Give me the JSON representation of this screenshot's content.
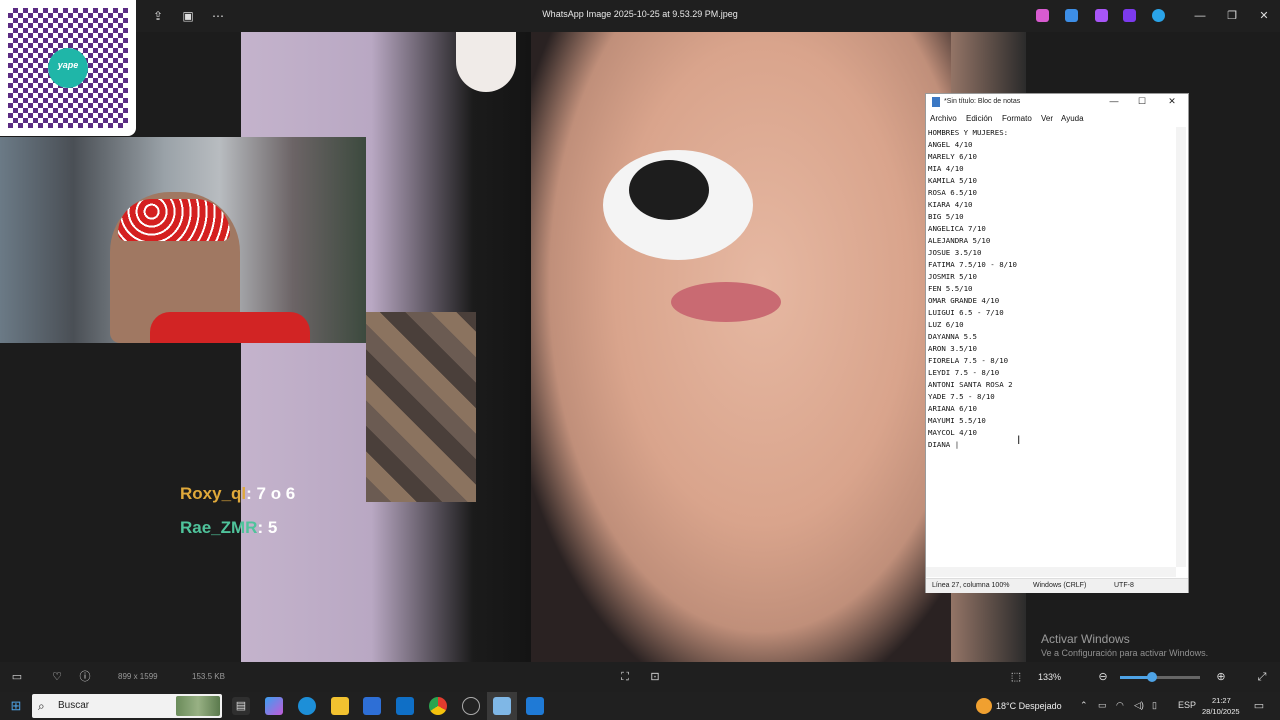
{
  "viewer": {
    "title": "WhatsApp Image 2025-10-25 at 9.53.29 PM.jpeg",
    "image_dimensions": "899 x 1599",
    "file_size": "153.5 KB",
    "zoom": "133%",
    "zoom_level_fraction": 0.4
  },
  "stream_overlay": {
    "qr_brand": "yape",
    "chat": [
      {
        "user": "Roxy_ql",
        "message": ": 7 o 6"
      },
      {
        "user": "Rae_ZMR",
        "message": ": 5"
      }
    ]
  },
  "notepad": {
    "title": "*Sin título: Bloc de notas",
    "menu": [
      "Archivo",
      "Edición",
      "Formato",
      "Ver",
      "Ayuda"
    ],
    "text": "HOMBRES Y MUJERES:\nANGEL 4/10\nMARELY 6/10\nMIA 4/10\nKAMILA 5/10\nROSA 6.5/10\nKIARA 4/10\nBIG 5/10\nANGELICA 7/10\nALEJANDRA 5/10\nJOSUE 3.5/10\nFATIMA 7.5/10 - 8/10\nJOSMIR 5/10\nFEN 5.5/10\nOMAR GRANDE 4/10\nLUIGUI 6.5 - 7/10\nLUZ 6/10\nDAYANNA 5.5\nARON 3.5/10\nFIORELA 7.5 - 8/10\nLEYDI 7.5 - 8/10\nANTONI SANTA ROSA 2\nYADE 7.5 - 8/10\nARIANA 6/10\nMAYUMI 5.5/10\nMAYCOL 4/10\nDIANA |",
    "status": {
      "position": "Línea 27, columna  100%",
      "line_ending": "Windows (CRLF)",
      "encoding": "UTF-8"
    }
  },
  "watermark": {
    "line1": "Activar Windows",
    "line2": "Ve a Configuración para activar Windows."
  },
  "taskbar": {
    "search_label": "Buscar",
    "weather": "18°C  Despejado",
    "language": "ESP",
    "time": "21:27",
    "date": "28/10/2025"
  },
  "colors": {
    "chat_user_1": "#e0a93a",
    "chat_user_2": "#4fc39b",
    "accent": "#4ea3e6"
  }
}
